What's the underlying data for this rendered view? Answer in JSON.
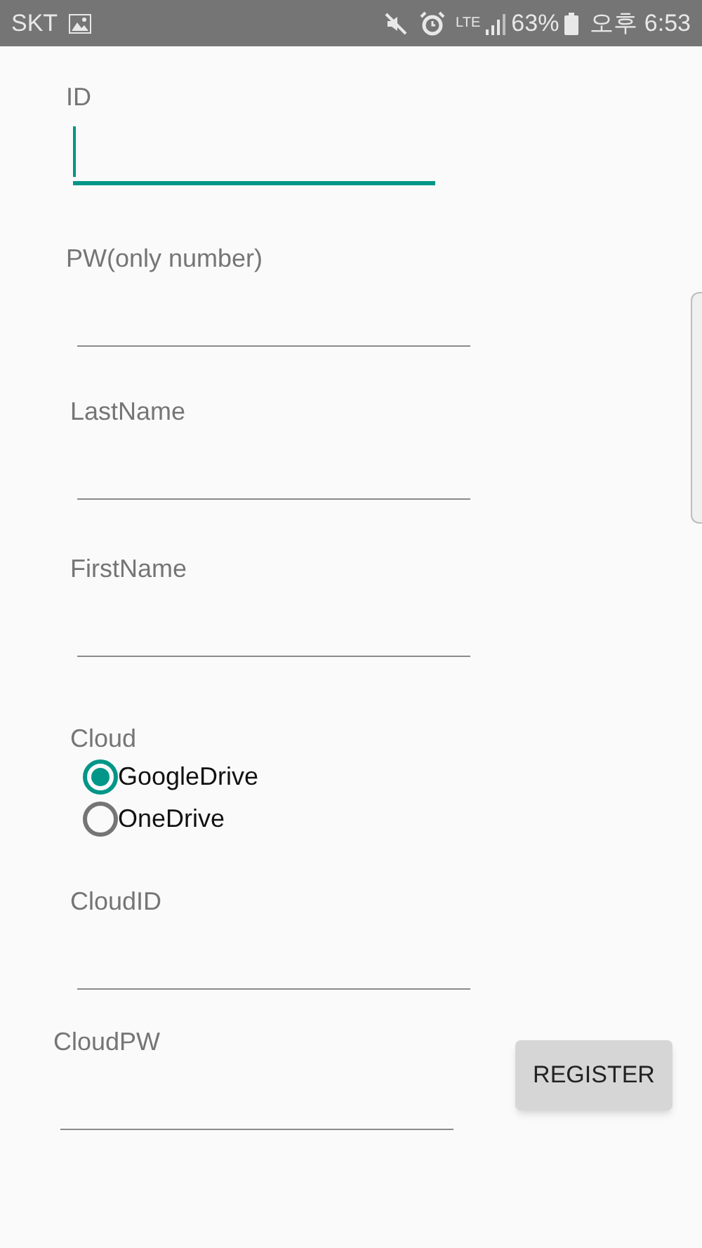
{
  "status_bar": {
    "carrier": "SKT",
    "network": "LTE",
    "battery": "63%",
    "time": "오후 6:53"
  },
  "form": [
    {
      "kind": "field",
      "label": "ID",
      "focused": true
    },
    {
      "kind": "field",
      "label": "PW(only number)",
      "focused": false
    },
    {
      "kind": "field",
      "label": "LastName",
      "focused": false
    },
    {
      "kind": "field",
      "label": "FirstName",
      "focused": false
    },
    {
      "kind": "radio_group",
      "label": "Cloud",
      "options": [
        {
          "label": "GoogleDrive",
          "selected": true
        },
        {
          "label": "OneDrive",
          "selected": false
        }
      ]
    },
    {
      "kind": "field",
      "label": "CloudID",
      "focused": false
    },
    {
      "kind": "field",
      "label": "CloudPW",
      "focused": false
    }
  ],
  "register_button": "REGISTER"
}
